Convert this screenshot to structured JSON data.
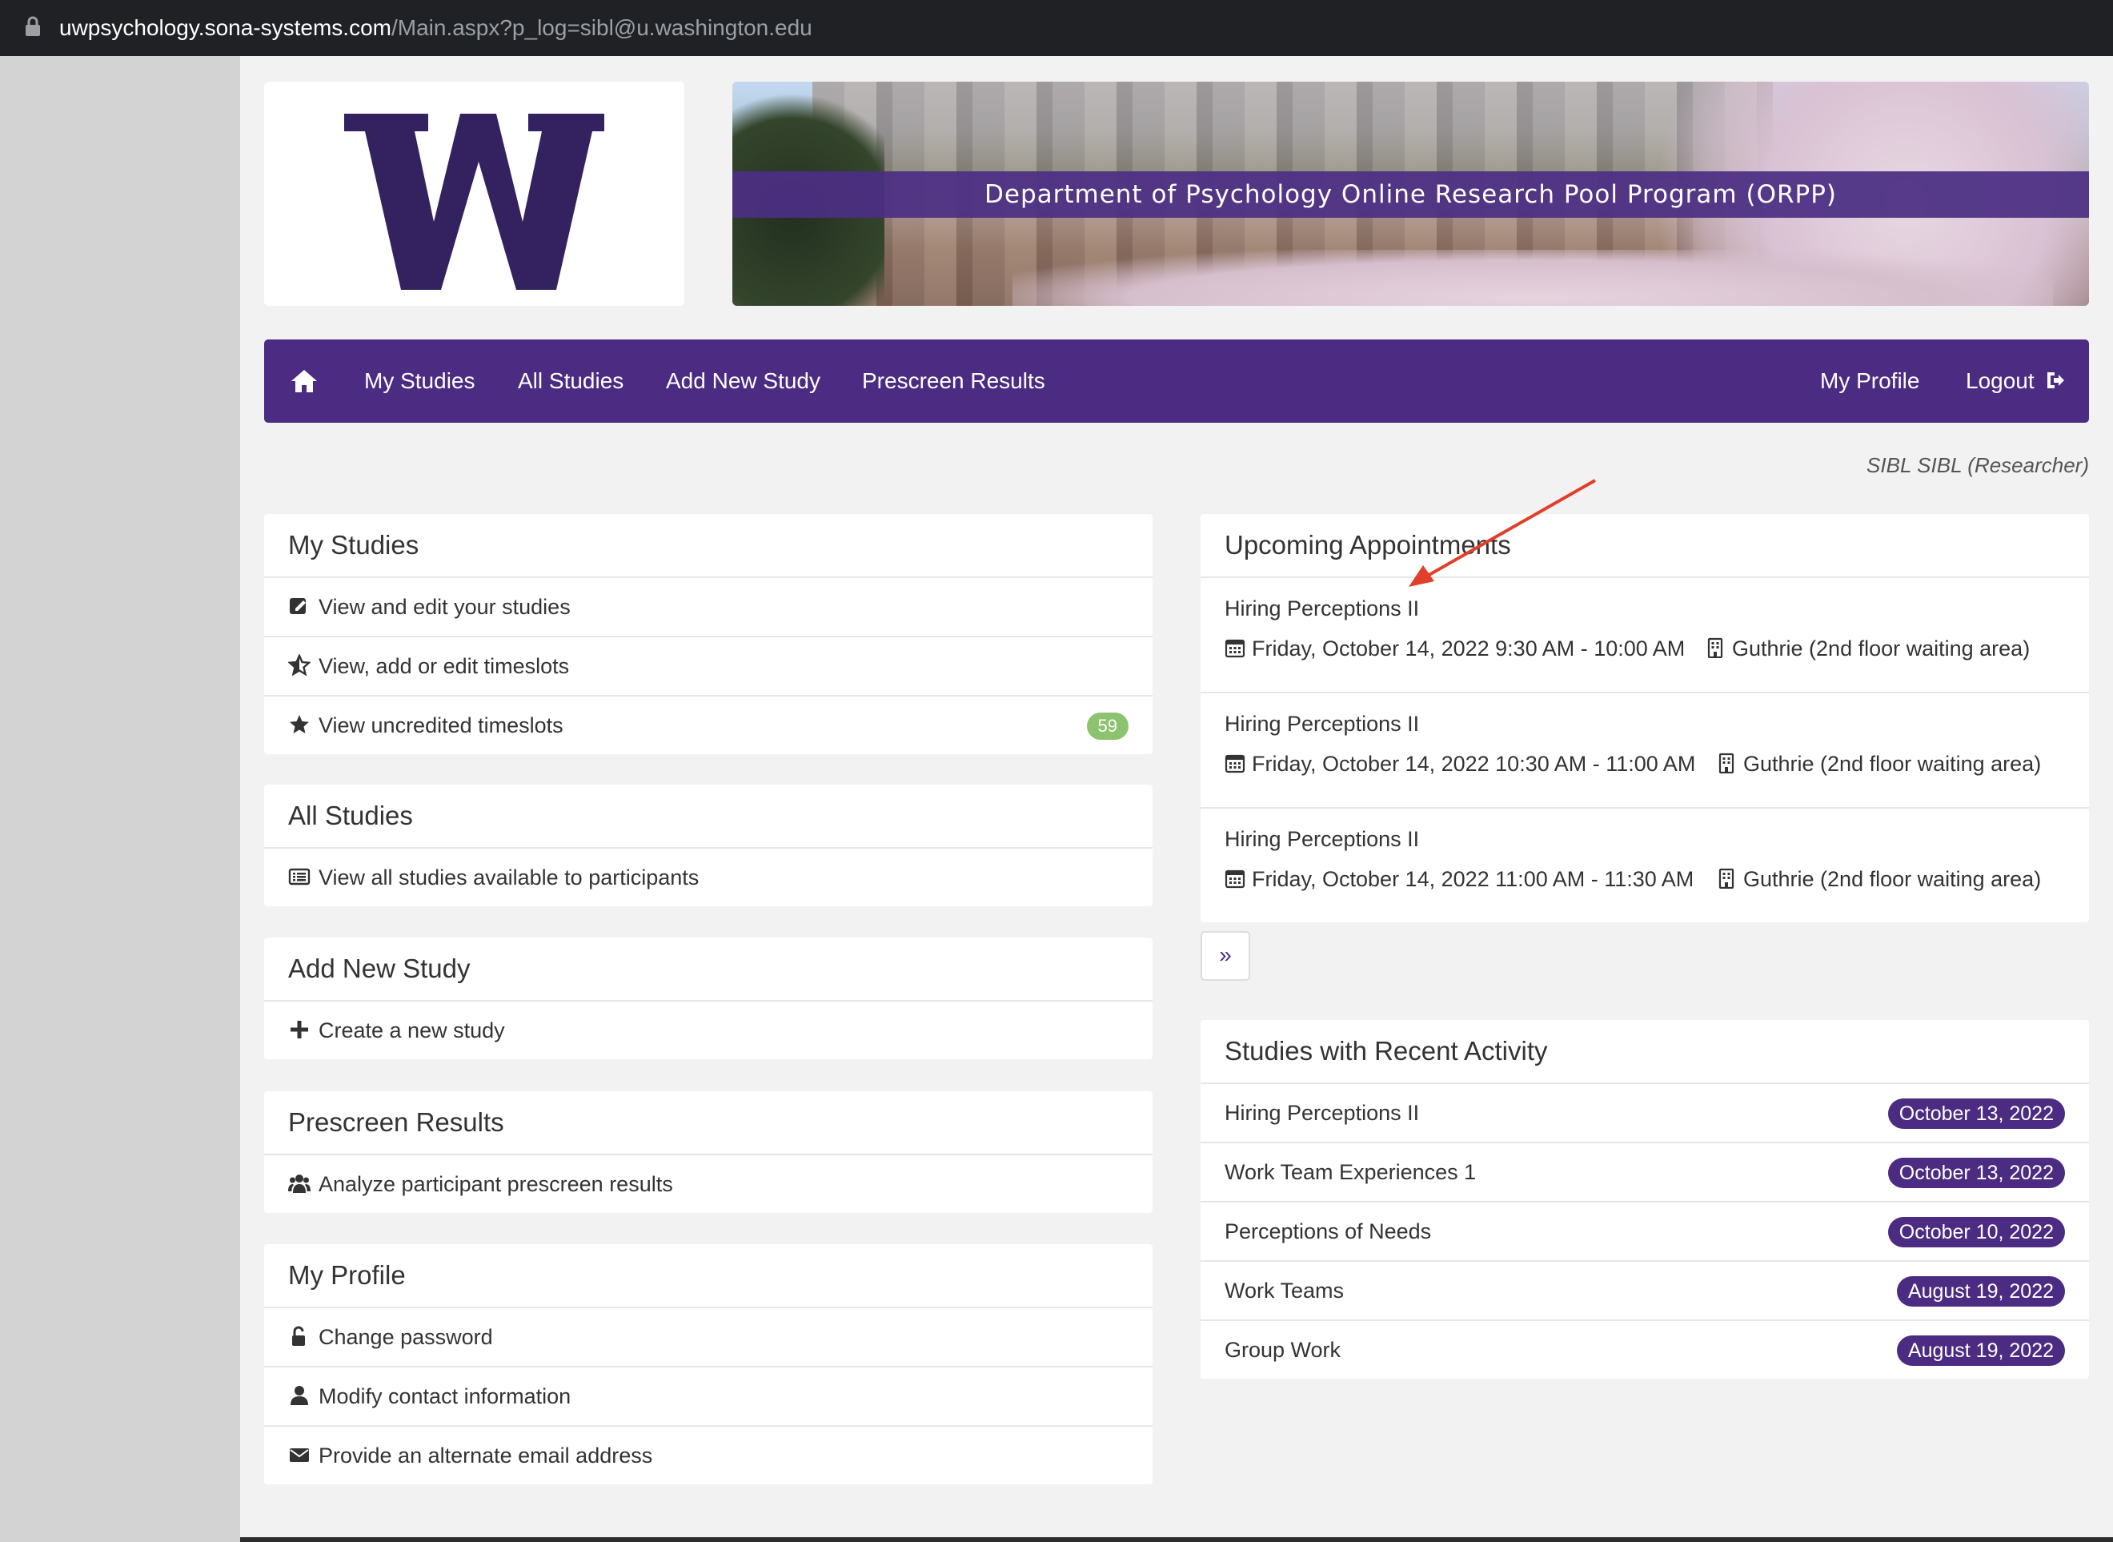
{
  "browser": {
    "url_host": "uwpsychology.sona-systems.com",
    "url_path": "/Main.aspx?p_log=sibl@u.washington.edu"
  },
  "header": {
    "logo_letter": "W",
    "banner_title": "Department of Psychology Online Research Pool Program (ORPP)"
  },
  "nav": {
    "home_icon": "home-icon",
    "items": [
      "My Studies",
      "All Studies",
      "Add New Study",
      "Prescreen Results"
    ],
    "right_items": [
      "My Profile",
      "Logout"
    ],
    "logout_icon": "logout-icon"
  },
  "user": {
    "display": "SIBL SIBL (Researcher)"
  },
  "colors": {
    "brand_purple": "#4b2c82",
    "badge_green": "#8dc26f",
    "annotation_arrow": "#e0402a"
  },
  "panels": {
    "my_studies": {
      "title": "My Studies",
      "rows": [
        {
          "icon": "edit-icon",
          "label": "View and edit your studies"
        },
        {
          "icon": "star-half-icon",
          "label": "View, add or edit timeslots"
        },
        {
          "icon": "star-icon",
          "label": "View uncredited timeslots",
          "badge": "59"
        }
      ]
    },
    "all_studies": {
      "title": "All Studies",
      "rows": [
        {
          "icon": "list-icon",
          "label": "View all studies available to participants"
        }
      ]
    },
    "add_new_study": {
      "title": "Add New Study",
      "rows": [
        {
          "icon": "plus-icon",
          "label": "Create a new study"
        }
      ]
    },
    "prescreen": {
      "title": "Prescreen Results",
      "rows": [
        {
          "icon": "users-icon",
          "label": "Analyze participant prescreen results"
        }
      ]
    },
    "my_profile": {
      "title": "My Profile",
      "rows": [
        {
          "icon": "unlock-icon",
          "label": "Change password"
        },
        {
          "icon": "user-icon",
          "label": "Modify contact information"
        },
        {
          "icon": "envelope-icon",
          "label": "Provide an alternate email address"
        }
      ]
    },
    "upcoming": {
      "title": "Upcoming Appointments",
      "appointments": [
        {
          "study": "Hiring Perceptions II",
          "when": "Friday, October 14, 2022 9:30 AM - 10:00 AM",
          "where": "Guthrie (2nd floor waiting area)"
        },
        {
          "study": "Hiring Perceptions II",
          "when": "Friday, October 14, 2022 10:30 AM - 11:00 AM",
          "where": "Guthrie (2nd floor waiting area)"
        },
        {
          "study": "Hiring Perceptions II",
          "when": "Friday, October 14, 2022 11:00 AM - 11:30 AM",
          "where": "Guthrie (2nd floor waiting area)"
        }
      ],
      "pager_label": "»"
    },
    "recent": {
      "title": "Studies with Recent Activity",
      "rows": [
        {
          "study": "Hiring Perceptions II",
          "date": "October 13, 2022"
        },
        {
          "study": "Work Team Experiences 1",
          "date": "October 13, 2022"
        },
        {
          "study": "Perceptions of Needs",
          "date": "October 10, 2022"
        },
        {
          "study": "Work Teams",
          "date": "August 19, 2022"
        },
        {
          "study": "Group Work",
          "date": "August 19, 2022"
        }
      ]
    }
  }
}
